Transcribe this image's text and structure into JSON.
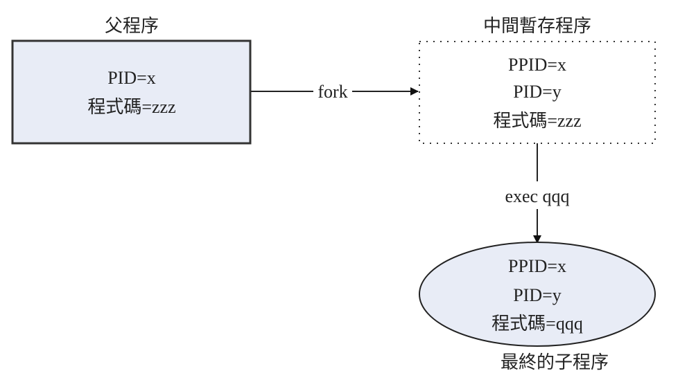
{
  "parent": {
    "title": "父程序",
    "lines": [
      "PID=x",
      "程式碼=zzz"
    ]
  },
  "fork_label": "fork",
  "intermediate": {
    "title": "中間暫存程序",
    "lines": [
      "PPID=x",
      "PID=y",
      "程式碼=zzz"
    ]
  },
  "exec_label": "exec qqq",
  "child": {
    "title": "最終的子程序",
    "lines": [
      "PPID=x",
      "PID=y",
      "程式碼=qqq"
    ]
  },
  "colors": {
    "fill": "#e8ecf6",
    "stroke": "#222222"
  }
}
